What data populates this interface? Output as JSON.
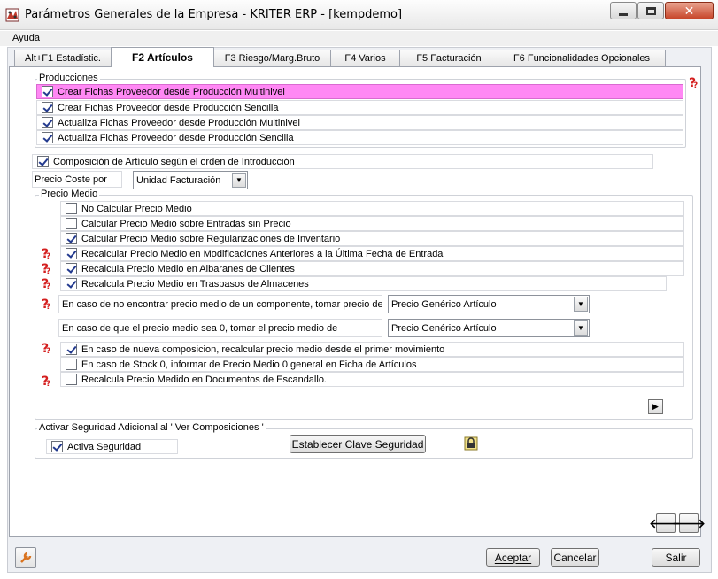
{
  "window": {
    "title": "Parámetros Generales de la Empresa - KRITER ERP - [kempdemo]"
  },
  "menu": {
    "items": [
      "Ayuda"
    ]
  },
  "tabs": [
    {
      "label": "Alt+F1 Estadístic."
    },
    {
      "label": "F2 Artículos"
    },
    {
      "label": "F3 Riesgo/Marg.Bruto"
    },
    {
      "label": "F4 Varios"
    },
    {
      "label": "F5 Facturación"
    },
    {
      "label": "F6 Funcionalidades Opcionales"
    }
  ],
  "producciones": {
    "legend": "Producciones",
    "items": [
      {
        "label": "Crear Fichas Proveedor desde Producción Multinivel",
        "checked": true
      },
      {
        "label": "Crear Fichas Proveedor desde Producción Sencilla",
        "checked": true
      },
      {
        "label": "Actualiza Fichas Proveedor desde Producción Multinivel",
        "checked": true
      },
      {
        "label": "Actualiza Fichas Proveedor desde Producción Sencilla",
        "checked": true
      }
    ]
  },
  "composicion": {
    "label": "Composición de Artículo según el orden de Introducción",
    "checked": true
  },
  "precio_coste": {
    "label": "Precio Coste por",
    "value": "Unidad Facturación"
  },
  "precio_medio": {
    "legend": "Precio Medio",
    "items": [
      {
        "label": "No Calcular Precio Medio",
        "checked": false
      },
      {
        "label": "Calcular Precio Medio sobre Entradas sin Precio",
        "checked": false
      },
      {
        "label": "Calcular Precio Medio sobre Regularizaciones de Inventario",
        "checked": true
      },
      {
        "label": "Recalcular Precio Medio en Modificaciones Anteriores a la Última Fecha de Entrada",
        "checked": true
      },
      {
        "label": "Recalcula Precio Medio en Albaranes de Clientes",
        "checked": true
      },
      {
        "label": "Recalcula Precio Medio en Traspasos de Almacenes",
        "checked": true
      }
    ],
    "no_encontrar": {
      "label": "En caso de no encontrar precio medio de un componente, tomar precio de",
      "value": "Precio Genérico Artículo"
    },
    "sea_cero": {
      "label": "En caso de que el precio medio sea 0, tomar el precio medio de",
      "value": "Precio Genérico Artículo"
    },
    "items2": [
      {
        "label": "En caso de nueva composicion, recalcular precio medio desde el primer movimiento",
        "checked": true
      },
      {
        "label": "En caso de Stock 0, informar de Precio Medio 0 general en Ficha de Artículos",
        "checked": false
      },
      {
        "label": "Recalcula Precio Medido en Documentos de Escandallo.",
        "checked": false
      }
    ]
  },
  "seguridad": {
    "legend": "Activar Seguridad Adicional al ' Ver Composiciones '",
    "checkbox": {
      "label": "Activa Seguridad",
      "checked": true
    },
    "button": "Establecer Clave Seguridad"
  },
  "footer": {
    "aceptar": "Aceptar",
    "cancelar": "Cancelar",
    "salir": "Salir"
  },
  "icons": {
    "app": "kriter-app-icon",
    "help": "help-question-icon",
    "lock": "lock-icon",
    "play": "play-arrow-icon",
    "back": "arrow-left-icon",
    "forward": "arrow-right-icon",
    "tools": "wrench-icon"
  },
  "colors": {
    "highlight": "#ff88f4",
    "help_red": "#d41f1f"
  }
}
